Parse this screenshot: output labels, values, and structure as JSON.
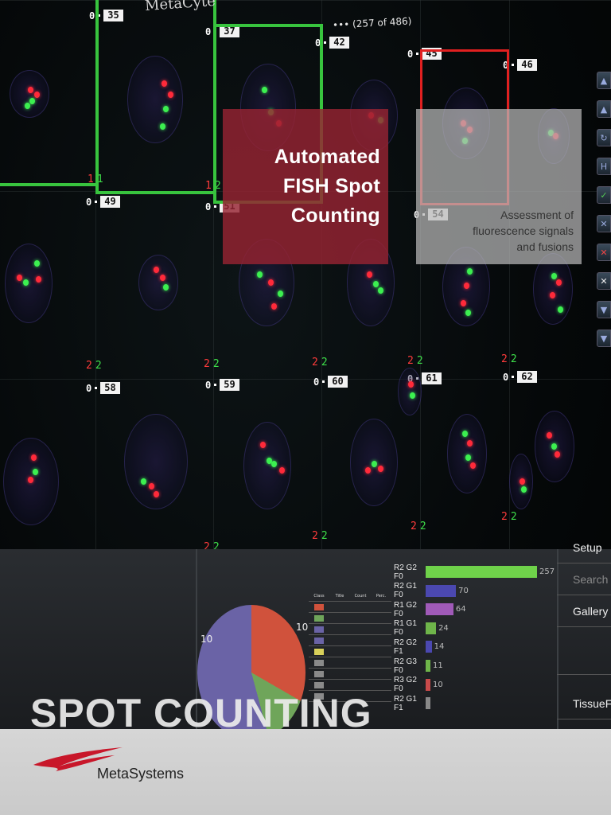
{
  "header": {
    "app_title": "MetaCyte",
    "page_counter": "(257 of 486)",
    "ellipsis": "•••"
  },
  "cells": {
    "row1": [
      "35",
      "37",
      "42",
      "45",
      "46"
    ],
    "row2": [
      "49",
      "51",
      "54"
    ],
    "row3": [
      "58",
      "59",
      "60",
      "61",
      "62"
    ],
    "zero": "0"
  },
  "spot_counts": {
    "red": "2",
    "green": "2",
    "red_alt": "1",
    "green_alt": "1"
  },
  "overlay": {
    "title_lines": [
      "Automated",
      "FISH Spot",
      "Counting"
    ],
    "subtitle_lines": [
      "Assessment of",
      "fluorescence signals",
      "and fusions"
    ]
  },
  "analysis": {
    "pie_labels": [
      "10",
      "10"
    ],
    "table_headers": [
      "Class",
      "Title",
      "Count",
      "Perc."
    ],
    "table_rows": [
      {
        "color": "#d0523c"
      },
      {
        "color": "#6fa55a"
      },
      {
        "color": "#6a63a6"
      },
      {
        "color": "#6a63a6"
      },
      {
        "color": "#d8d05a"
      },
      {
        "color": "#8a8a8a"
      },
      {
        "color": "#8a8a8a"
      },
      {
        "color": "#8a8a8a"
      },
      {
        "color": "#8a8a8a"
      }
    ],
    "bars": [
      {
        "label": "R2 G2 F0",
        "value": "257",
        "color": "#6fd24a"
      },
      {
        "label": "R2 G1 F0",
        "value": "70",
        "color": "#4b48b0"
      },
      {
        "label": "R1 G2 F0",
        "value": "64",
        "color": "#a05ab8"
      },
      {
        "label": "R1 G1 F0",
        "value": "24",
        "color": "#6fb54a"
      },
      {
        "label": "R2 G2 F1",
        "value": "14",
        "color": "#4b48b0"
      },
      {
        "label": "R2 G3 F0",
        "value": "11",
        "color": "#6fb54a"
      },
      {
        "label": "R3 G2 F0",
        "value": "10",
        "color": "#c84a4a"
      },
      {
        "label": "R2 G1 F1",
        "value": "",
        "color": "#888888"
      }
    ]
  },
  "side_menu": [
    "Setup",
    "Search",
    "Gallery",
    "",
    "TissueFISH"
  ],
  "footer": {
    "headline": "SPOT COUNTING",
    "brand": "MetaSystems"
  },
  "colors": {
    "accent_red": "#962332",
    "select_green": "#38c43e",
    "select_red": "#e02020"
  }
}
